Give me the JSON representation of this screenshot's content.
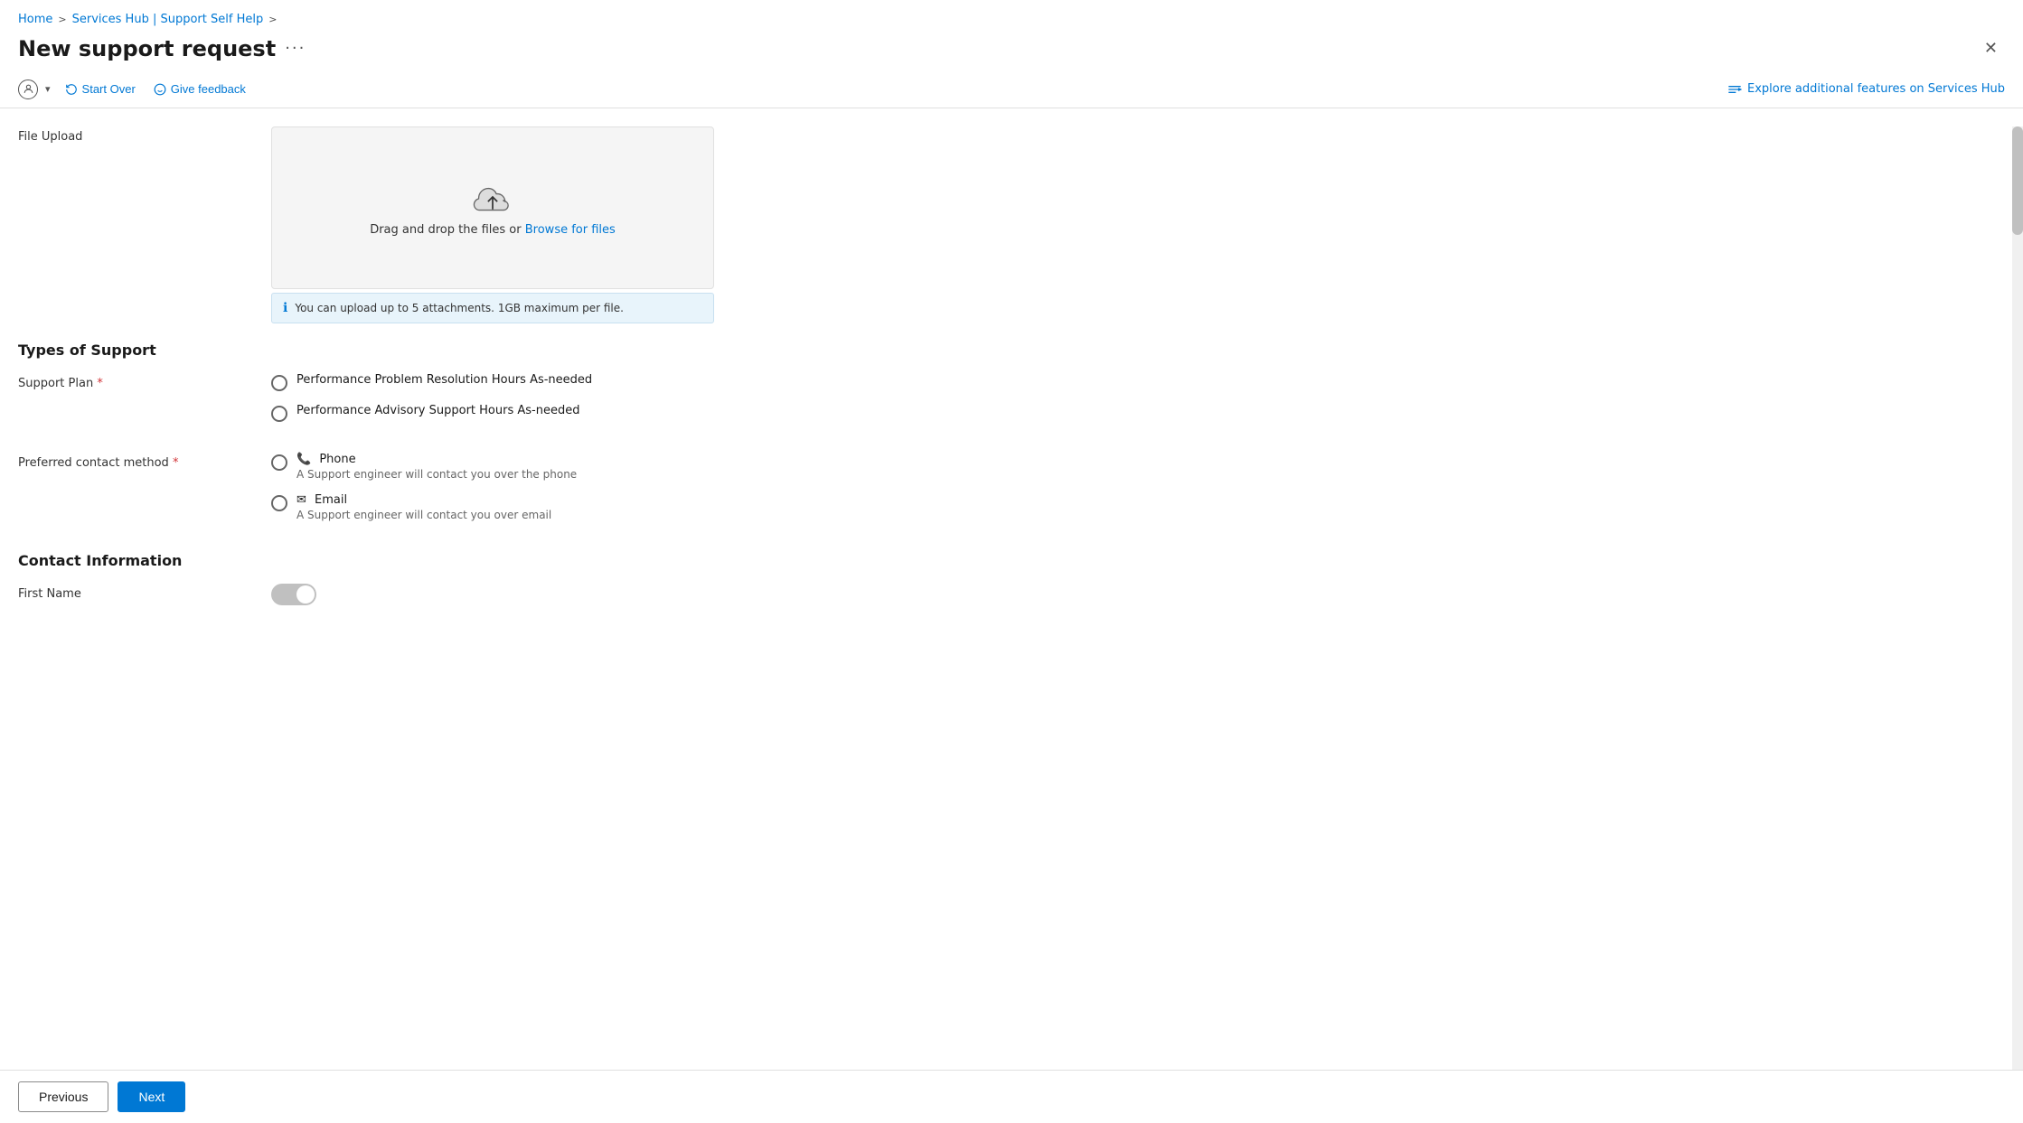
{
  "breadcrumb": {
    "home": "Home",
    "separator1": ">",
    "current": "Services Hub | Support Self Help",
    "arrow": ">"
  },
  "page": {
    "title": "New support request",
    "dots": "···"
  },
  "toolbar": {
    "start_over_label": "Start Over",
    "give_feedback_label": "Give feedback",
    "explore_label": "Explore additional features on Services Hub"
  },
  "file_upload": {
    "label": "File Upload",
    "drag_text": "Drag and drop the files or",
    "browse_link": "Browse for files",
    "info_text": "You can upload up to 5 attachments. 1GB maximum per file."
  },
  "types_of_support": {
    "heading": "Types of Support",
    "support_plan": {
      "label": "Support Plan",
      "required": true,
      "options": [
        {
          "value": "performance_resolution",
          "label": "Performance Problem Resolution Hours As-needed"
        },
        {
          "value": "performance_advisory",
          "label": "Performance Advisory Support Hours As-needed"
        }
      ]
    },
    "preferred_contact": {
      "label": "Preferred contact method",
      "required": true,
      "options": [
        {
          "value": "phone",
          "icon": "📞",
          "label": "Phone",
          "sublabel": "A Support engineer will contact you over the phone"
        },
        {
          "value": "email",
          "icon": "✉",
          "label": "Email",
          "sublabel": "A Support engineer will contact you over email"
        }
      ]
    }
  },
  "contact_information": {
    "heading": "Contact Information",
    "first_name_label": "First Name"
  },
  "navigation": {
    "previous": "Previous",
    "next": "Next"
  },
  "close_btn": "✕"
}
